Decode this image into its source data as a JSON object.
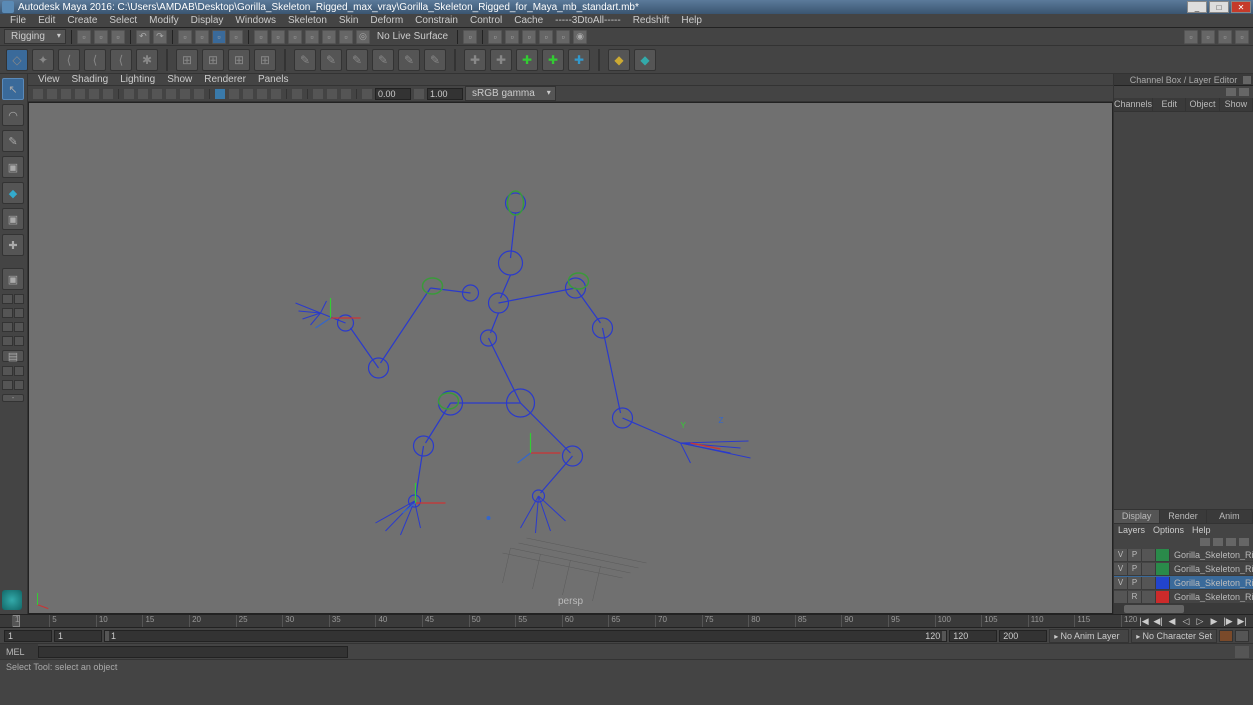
{
  "titlebar": {
    "app": "Autodesk Maya 2016:",
    "path": "C:\\Users\\AMDAB\\Desktop\\Gorilla_Skeleton_Rigged_max_vray\\Gorilla_Skeleton_Rigged_for_Maya_mb_standart.mb*"
  },
  "menubar": [
    "File",
    "Edit",
    "Create",
    "Select",
    "Modify",
    "Display",
    "Windows",
    "Skeleton",
    "Skin",
    "Deform",
    "Constrain",
    "Control",
    "Cache",
    "-----3DtoAll-----",
    "Redshift",
    "Help"
  ],
  "workspace_dropdown": "Rigging",
  "status_text": "No Live Surface",
  "panel_menus": [
    "View",
    "Shading",
    "Lighting",
    "Show",
    "Renderer",
    "Panels"
  ],
  "viewport": {
    "camera": "persp",
    "near": "0.00",
    "far": "1.00",
    "color_mgmt": "sRGB gamma"
  },
  "channel_box": {
    "title": "Channel Box / Layer Editor",
    "tabs": [
      "Channels",
      "Edit",
      "Object",
      "Show"
    ]
  },
  "layer_editor": {
    "tabs": [
      "Display",
      "Render",
      "Anim"
    ],
    "active_tab": "Display",
    "menus": [
      "Layers",
      "Options",
      "Help"
    ],
    "layers": [
      {
        "v": "V",
        "p": "P",
        "color": "#2a8a4a",
        "name": "Gorilla_Skeleton_Rigg",
        "selected": false
      },
      {
        "v": "V",
        "p": "P",
        "color": "#2a8a4a",
        "name": "Gorilla_Skeleton_Rigg",
        "selected": false
      },
      {
        "v": "V",
        "p": "P",
        "color": "#2244cc",
        "name": "Gorilla_Skeleton_Rigg",
        "selected": true
      },
      {
        "v": "",
        "p": "R",
        "color": "#cc2a2a",
        "name": "Gorilla_Skeleton_Rigg",
        "selected": false
      }
    ]
  },
  "timeline": {
    "ticks": [
      1,
      5,
      10,
      15,
      20,
      25,
      30,
      35,
      40,
      45,
      50,
      55,
      60,
      65,
      70,
      75,
      80,
      85,
      90,
      95,
      100,
      105,
      110,
      115,
      120
    ],
    "current": "1",
    "range_start": "1",
    "range_end": "120",
    "anim_start": "1",
    "anim_end": "120",
    "total_end": "200",
    "anim_layer": "No Anim Layer",
    "char_set": "No Character Set"
  },
  "cmd_label": "MEL",
  "helpline": "Select Tool: select an object"
}
